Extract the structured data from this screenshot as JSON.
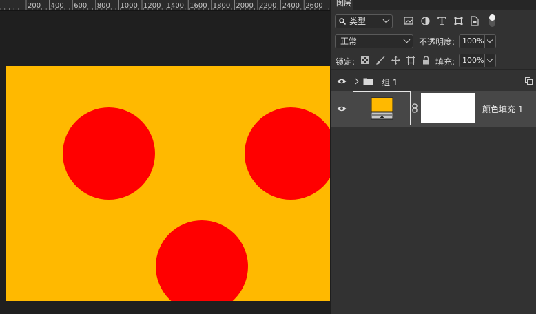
{
  "ruler": {
    "labels": [
      "200",
      "400",
      "600",
      "800",
      "1000",
      "1200",
      "1400",
      "1600",
      "1800",
      "2000",
      "2200",
      "2400",
      "2600"
    ]
  },
  "colors": {
    "canvas_bg": "#ffb900",
    "circle": "#ff0000",
    "arrow": "#e8343a",
    "fill_swatch": "#ffb900",
    "mask": "#ffffff"
  },
  "panel": {
    "tab_label": "图层",
    "filter": {
      "icon": "search-icon",
      "label": "类型"
    },
    "blend_mode": {
      "label": "正常"
    },
    "opacity": {
      "label": "不透明度:",
      "value": "100%"
    },
    "lock": {
      "label": "锁定:"
    },
    "fill": {
      "label": "填充:",
      "value": "100%"
    },
    "layers": [
      {
        "name": "组 1",
        "type": "group",
        "visible": true
      },
      {
        "name": "颜色填充 1",
        "type": "fill",
        "visible": true,
        "selected": true
      }
    ]
  }
}
